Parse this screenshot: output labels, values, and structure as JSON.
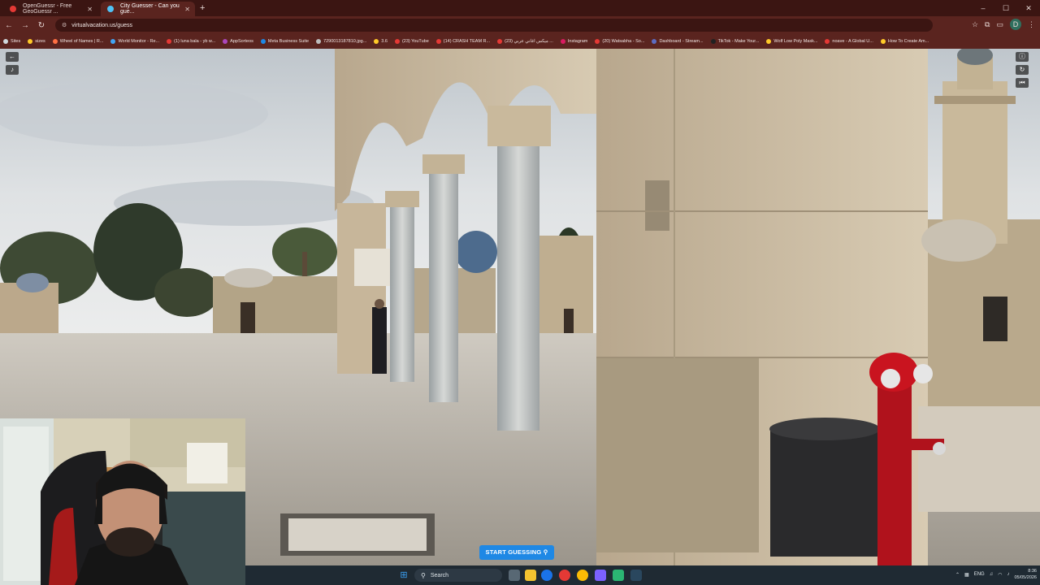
{
  "browser": {
    "tabs": [
      {
        "label": "OpenGuessr - Free GeoGuessr ...",
        "active": false,
        "favicon_color": "#e53935"
      },
      {
        "label": "City Guesser - Can you gue...",
        "active": true,
        "favicon_color": "#4fc3f7"
      }
    ],
    "new_tab": "+",
    "url": "virtualvacation.us/guess",
    "bookmarks": [
      {
        "label": "Sites",
        "color": "#cfd8dc"
      },
      {
        "label": "sizes",
        "color": "#ffca28"
      },
      {
        "label": "Wheel of Names | R...",
        "color": "#ff7043"
      },
      {
        "label": "World Monitor - Re...",
        "color": "#42a5f5"
      },
      {
        "label": "(1) luna bala - yb w...",
        "color": "#e53935"
      },
      {
        "label": "AppSorteos",
        "color": "#ab47bc"
      },
      {
        "label": "Meta Business Suite",
        "color": "#1e88e5"
      },
      {
        "label": "7290013187810.jpg...",
        "color": "#bdbdbd"
      },
      {
        "label": "3.6",
        "color": "#ffca28"
      },
      {
        "label": "(23) YouTube",
        "color": "#e53935"
      },
      {
        "label": "(14) CRASH TEAM R...",
        "color": "#e53935"
      },
      {
        "label": "(23) ميكس اغاني عربي ...",
        "color": "#e53935"
      },
      {
        "label": "Instagram",
        "color": "#d81b60"
      },
      {
        "label": "(20) Watsabha - So...",
        "color": "#e53935"
      },
      {
        "label": "Dashboard - Stream...",
        "color": "#5c6bc0"
      },
      {
        "label": "TikTok - Make Your...",
        "color": "#212121"
      },
      {
        "label": "Wolf Low Poly Mask...",
        "color": "#ffca28"
      },
      {
        "label": "noave - A Global U...",
        "color": "#e53935"
      },
      {
        "label": "How To Create Am...",
        "color": "#ffca28"
      }
    ],
    "profile_initial": "D"
  },
  "game": {
    "start_button": "START GUESSING",
    "start_icon": "map-pin-icon",
    "controls_left": [
      "back-arrow-icon",
      "volume-icon"
    ],
    "controls_right": [
      "info-icon",
      "refresh-icon",
      "skip-back-icon"
    ]
  },
  "taskbar": {
    "search_placeholder": "Search",
    "language": "ENG",
    "time": "8:36",
    "date": "05/05/2026"
  },
  "colors": {
    "browser_frame": "#3b1512",
    "browser_toolbar": "#5a241f",
    "accent_button": "#1e88e5",
    "taskbar": "#1f2a33"
  }
}
